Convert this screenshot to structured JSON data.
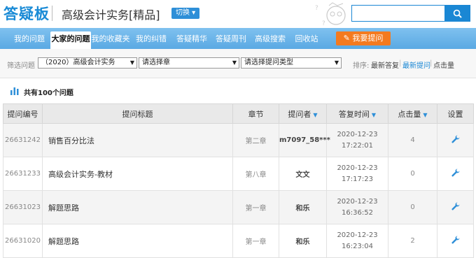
{
  "header": {
    "logo": "答疑板",
    "subject": "高级会计实务[精品]",
    "switch_label": "切换",
    "search": {
      "value": "",
      "placeholder": ""
    }
  },
  "nav": {
    "items": [
      {
        "label": "我的问题",
        "active": false
      },
      {
        "label": "大家的问题",
        "active": true
      },
      {
        "label": "我的收藏夹",
        "active": false
      },
      {
        "label": "我的纠错",
        "active": false
      },
      {
        "label": "答疑精华",
        "active": false
      },
      {
        "label": "答疑周刊",
        "active": false
      },
      {
        "label": "高级搜索",
        "active": false
      },
      {
        "label": "回收站",
        "active": false
      }
    ],
    "ask_button": "我要提问"
  },
  "filter": {
    "label": "筛选问题",
    "course": "（2020）高级会计实务",
    "chapter": "请选择章",
    "type": "请选择提问类型",
    "sort_label": "排序:",
    "sort_options": [
      "最新答复",
      "最新提问",
      "点击量"
    ],
    "sort_active": "最新提问"
  },
  "summary": {
    "count_text": "共有100个问题"
  },
  "table": {
    "headers": [
      "提问编号",
      "提问标题",
      "章节",
      "提问者",
      "答复时间",
      "点击量",
      "设置"
    ],
    "rows": [
      {
        "id": "26631242",
        "title": "销售百分比法",
        "chapter": "第二章",
        "asker": "m7097_58***",
        "date": "2020-12-23",
        "time": "17:22:01",
        "clicks": "4"
      },
      {
        "id": "26631233",
        "title": "高级会计实务-教材",
        "chapter": "第八章",
        "asker": "文文",
        "date": "2020-12-23",
        "time": "17:17:23",
        "clicks": "0"
      },
      {
        "id": "26631023",
        "title": "解题思路",
        "chapter": "第一章",
        "asker": "和乐",
        "date": "2020-12-23",
        "time": "16:36:52",
        "clicks": "0"
      },
      {
        "id": "26631020",
        "title": "解题思路",
        "chapter": "第一章",
        "asker": "和乐",
        "date": "2020-12-23",
        "time": "16:23:04",
        "clicks": "2"
      }
    ]
  },
  "colors": {
    "accent": "#1a87d4",
    "nav_bg": "#6db5ea",
    "ask_button": "#f47a1f"
  },
  "icons": {
    "search": "search-icon",
    "settings": "wrench-icon",
    "ask": "pencil-icon",
    "count": "bar-chart-icon"
  }
}
